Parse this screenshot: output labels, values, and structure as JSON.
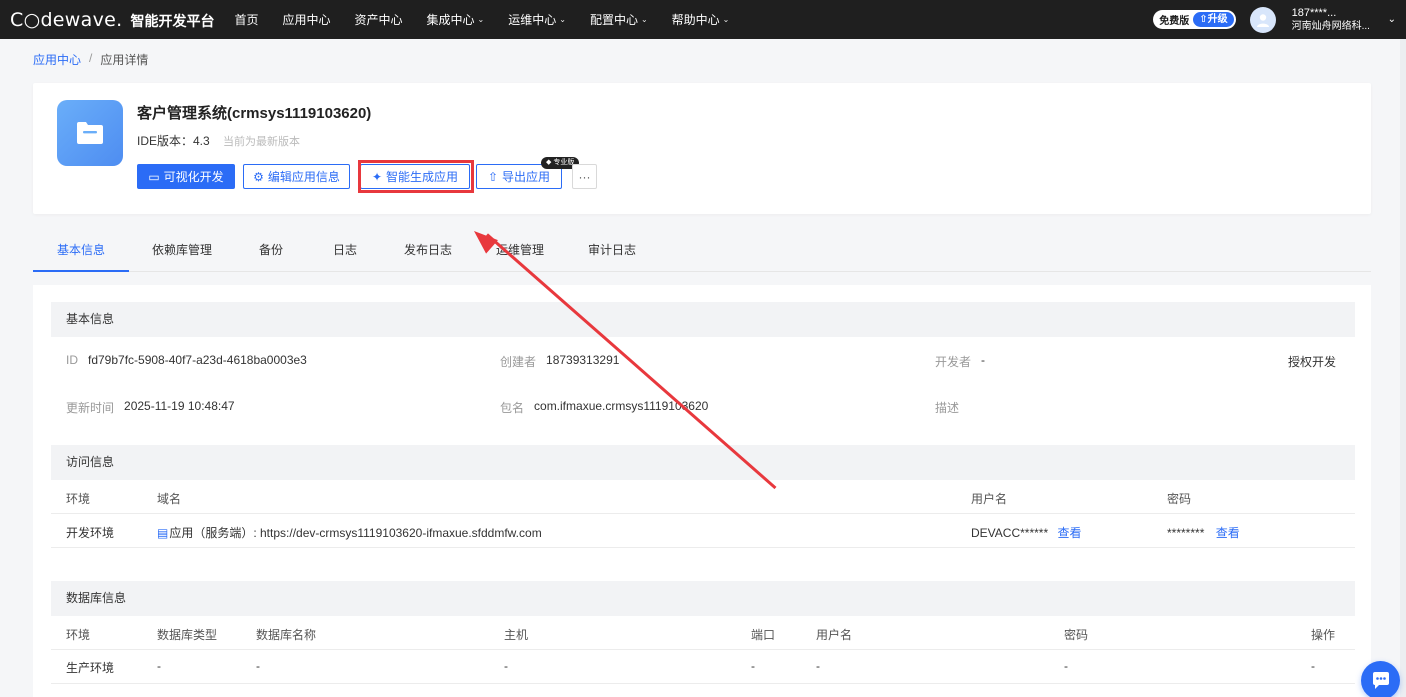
{
  "header": {
    "logo": "C○dewave.",
    "platform": "智能开发平台",
    "nav": [
      {
        "label": "首页",
        "dropdown": false
      },
      {
        "label": "应用中心",
        "dropdown": false
      },
      {
        "label": "资产中心",
        "dropdown": false
      },
      {
        "label": "集成中心",
        "dropdown": true
      },
      {
        "label": "运维中心",
        "dropdown": true
      },
      {
        "label": "配置中心",
        "dropdown": true
      },
      {
        "label": "帮助中心",
        "dropdown": true
      }
    ],
    "plan": "免费版",
    "upgrade": "⇧升级",
    "user_phone": "187****...",
    "user_org": "河南灿舟网络科...",
    "accent": "#2b6cf6",
    "bar_bg": "#1f1f1f"
  },
  "breadcrumb": {
    "parent": "应用中心",
    "separator": "/",
    "current": "应用详情"
  },
  "app": {
    "title": "客户管理系统(crmsys1119103620)",
    "ide_version_label": "IDE版本：4.3",
    "ide_version_note": "当前为最新版本",
    "buttons": {
      "visual_dev": "可视化开发",
      "edit_info": "编辑应用信息",
      "ai_generate": "智能生成应用",
      "export": "导出应用",
      "more": "···"
    },
    "pro_badge": "◆ 专业版",
    "highlight_color": "#e8383d"
  },
  "tabs": [
    "基本信息",
    "依赖库管理",
    "备份",
    "日志",
    "发布日志",
    "运维管理",
    "审计日志"
  ],
  "active_tab": "基本信息",
  "basic_info": {
    "title": "基本信息",
    "id_label": "ID",
    "id_value": "fd79b7fc-5908-40f7-a23d-4618ba0003e3",
    "creator_label": "创建者",
    "creator_value": "18739313291",
    "developer_label": "开发者",
    "developer_value": "-",
    "authorize_link": "授权开发",
    "updated_label": "更新时间",
    "updated_value": "2025-11-19 10:48:47",
    "package_label": "包名",
    "package_value": "com.ifmaxue.crmsys1119103620",
    "desc_label": "描述"
  },
  "access_info": {
    "title": "访问信息",
    "columns": [
      "环境",
      "域名",
      "用户名",
      "密码"
    ],
    "rows": [
      {
        "env": "开发环境",
        "domain": "应用（服务端）: https://dev-crmsys1119103620-ifmaxue.sfddmfw.com",
        "username": "DEVACC******",
        "username_link": "查看",
        "password": "********",
        "password_link": "查看"
      }
    ]
  },
  "db_info": {
    "title": "数据库信息",
    "columns": [
      "环境",
      "数据库类型",
      "数据库名称",
      "主机",
      "端口",
      "用户名",
      "密码",
      "操作"
    ],
    "rows": [
      {
        "env": "生产环境",
        "type": "-",
        "name": "-",
        "host": "-",
        "port": "-",
        "user": "-",
        "password": "-",
        "action": "-"
      }
    ]
  }
}
